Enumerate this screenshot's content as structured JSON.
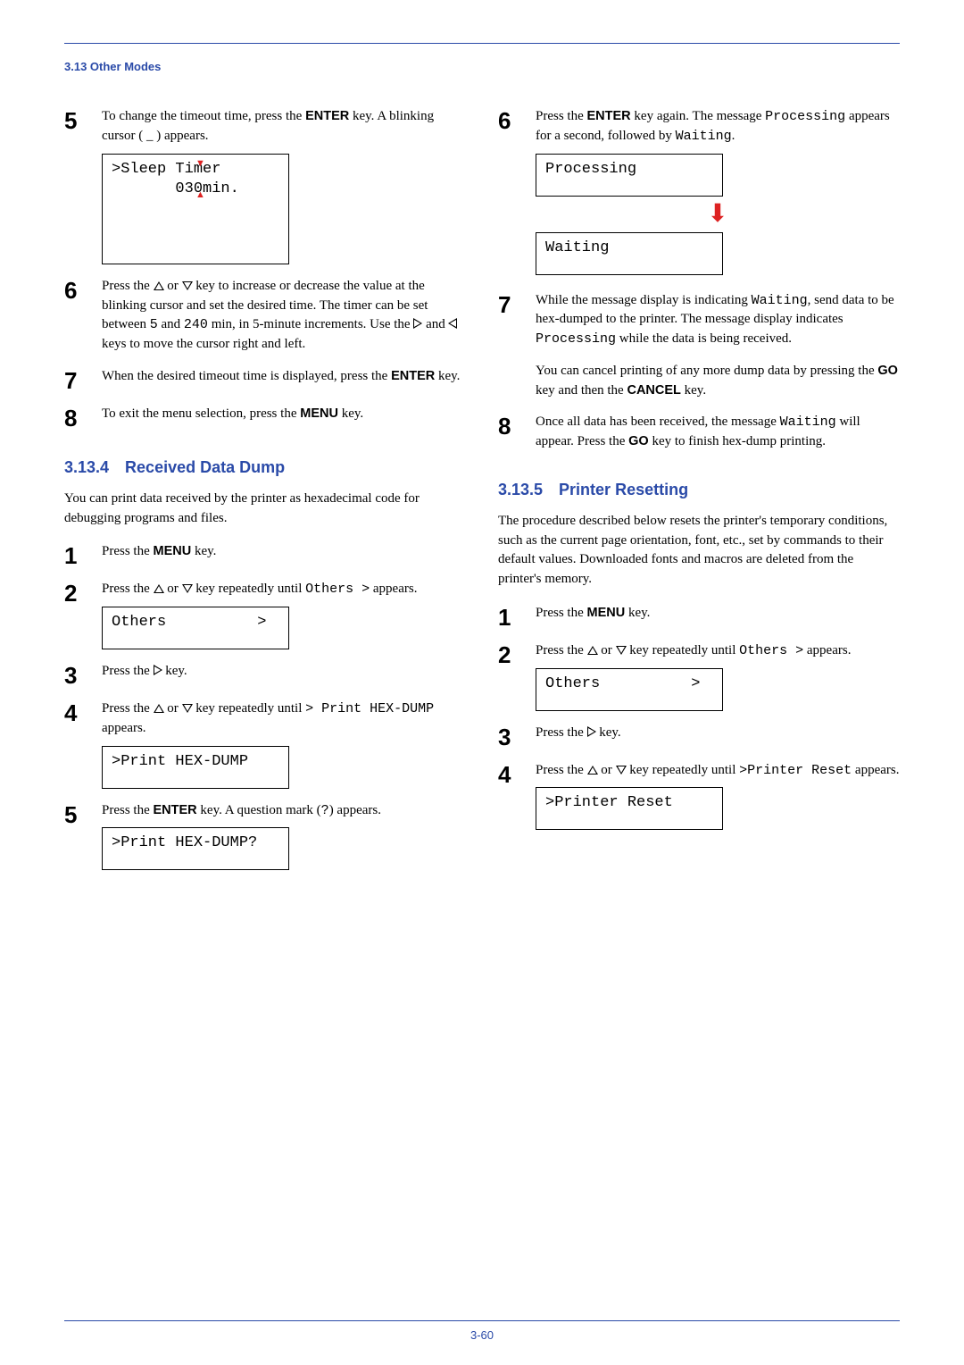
{
  "header": {
    "title": "3.13 Other Modes"
  },
  "footer": {
    "page": "3-60"
  },
  "left": {
    "step5": {
      "text_a": "To change the timeout time, press the ",
      "key1": "ENTER",
      "text_b": " key. A blinking cursor ( _ ) appears.",
      "lcd_line1": ">Sleep Timer",
      "lcd_line2": "       030min."
    },
    "step6": {
      "text_a": "Press the ",
      "text_b": " or ",
      "text_c": " key to increase or decrease the value at the blinking cursor and set the desired time. The timer can be set between ",
      "val1": "5",
      "text_d": " and ",
      "val2": "240",
      "text_e": " min, in 5-minute increments. Use the ",
      "text_f": " and ",
      "text_g": " keys to move the cursor right and left."
    },
    "step7": {
      "text_a": "When the desired timeout time is displayed, press the ",
      "key1": "ENTER",
      "text_b": " key."
    },
    "step8": {
      "text_a": "To exit the menu selection, press the ",
      "key1": "MENU",
      "text_b": " key."
    },
    "sec134": {
      "num": "3.13.4",
      "title": "Received Data Dump",
      "intro": "You can print data received by the printer as hexadecimal code for debugging programs and files."
    },
    "d_step1": {
      "text_a": "Press the ",
      "key1": "MENU",
      "text_b": " key."
    },
    "d_step2": {
      "text_a": "Press the ",
      "text_b": " or ",
      "text_c": " key repeatedly until ",
      "val": "Others  >",
      "text_d": " appears.",
      "lcd": "Others          >"
    },
    "d_step3": {
      "text_a": "Press the ",
      "text_b": " key."
    },
    "d_step4": {
      "text_a": "Press the ",
      "text_b": " or ",
      "text_c": " key repeatedly until ",
      "val": "> Print HEX-DUMP",
      "text_d": " appears.",
      "lcd": ">Print HEX-DUMP"
    },
    "d_step5": {
      "text_a": "Press the ",
      "key1": "ENTER",
      "text_b": " key. A question mark (",
      "q": "?",
      "text_c": ") appears.",
      "lcd": ">Print HEX-DUMP?"
    }
  },
  "right": {
    "step6": {
      "text_a": "Press the ",
      "key1": "ENTER",
      "text_b": " key again. The message ",
      "val1": "Processing",
      "text_c": " appears for a second, followed by ",
      "val2": "Waiting",
      "text_d": ".",
      "lcd1": "Processing",
      "lcd2": "Waiting"
    },
    "step7": {
      "text_a": "While the message display is indicating ",
      "val1": "Waiting",
      "text_b": ", send data to be hex-dumped to the printer. The message display indicates ",
      "val2": "Processing",
      "text_c": " while the data is being received.",
      "para2_a": "You can cancel printing of any more dump data by pressing the ",
      "key1": "GO",
      "para2_b": " key and then the ",
      "key2": "CANCEL",
      "para2_c": " key."
    },
    "step8": {
      "text_a": "Once all data has been received, the message ",
      "val1": "Waiting",
      "text_b": " will appear. Press the ",
      "key1": "GO",
      "text_c": " key to finish hex-dump printing."
    },
    "sec135": {
      "num": "3.13.5",
      "title": "Printer Resetting",
      "intro": "The procedure described below resets the printer's temporary conditions, such as the current page orientation, font, etc., set by commands to their default values. Downloaded fonts and macros are deleted from the printer's memory."
    },
    "r_step1": {
      "text_a": "Press the ",
      "key1": "MENU",
      "text_b": " key."
    },
    "r_step2": {
      "text_a": "Press the ",
      "text_b": " or ",
      "text_c": " key repeatedly until ",
      "val": "Others  >",
      "text_d": " appears.",
      "lcd": "Others          >"
    },
    "r_step3": {
      "text_a": "Press the ",
      "text_b": " key."
    },
    "r_step4": {
      "text_a": "Press the ",
      "text_b": " or ",
      "text_c": " key repeatedly until ",
      "val": ">Printer Reset",
      "text_d": " appears.",
      "lcd": ">Printer Reset"
    }
  }
}
